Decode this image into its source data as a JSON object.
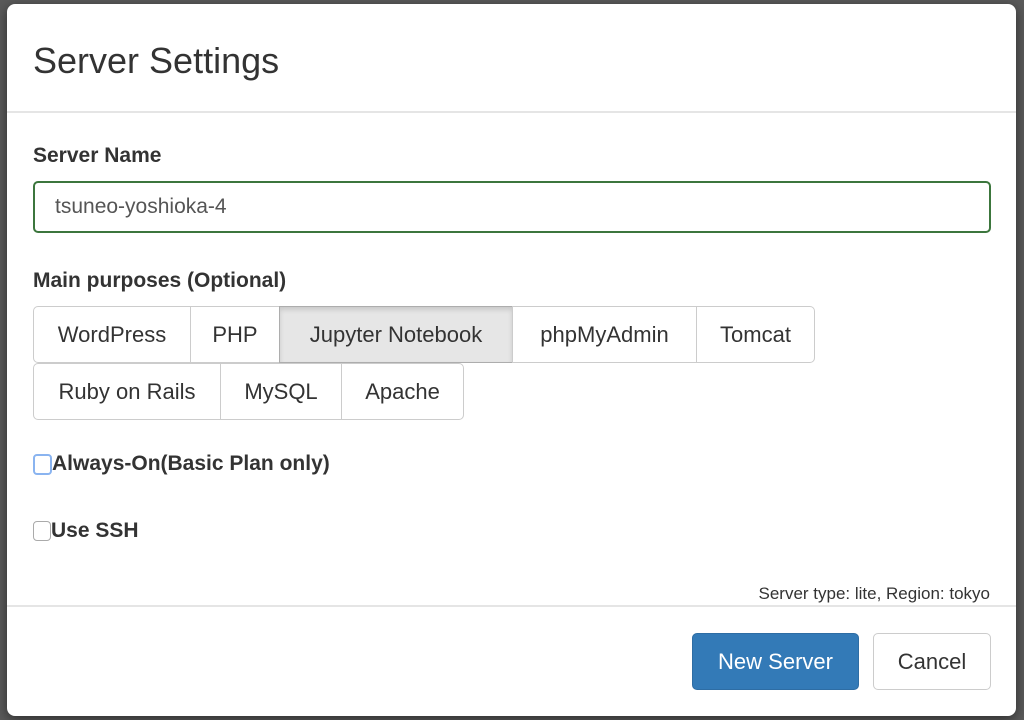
{
  "dialog": {
    "title": "Server Settings"
  },
  "server_name": {
    "label": "Server Name",
    "value": "tsuneo-yoshioka-4"
  },
  "purposes": {
    "label": "Main purposes (Optional)",
    "options": [
      {
        "label": "WordPress",
        "active": false
      },
      {
        "label": "PHP",
        "active": false
      },
      {
        "label": "Jupyter Notebook",
        "active": true
      },
      {
        "label": "phpMyAdmin",
        "active": false
      },
      {
        "label": "Tomcat",
        "active": false
      },
      {
        "label": "Ruby on Rails",
        "active": false
      },
      {
        "label": "MySQL",
        "active": false
      },
      {
        "label": "Apache",
        "active": false
      }
    ]
  },
  "options": {
    "always_on": {
      "label": "Always-On(Basic Plan only)",
      "checked": false
    },
    "use_ssh": {
      "label": "Use SSH",
      "checked": false
    }
  },
  "meta": "Server type: lite, Region: tokyo",
  "footer": {
    "primary": "New Server",
    "cancel": "Cancel"
  },
  "colors": {
    "primary": "#337ab7",
    "valid_border": "#3c763d"
  }
}
